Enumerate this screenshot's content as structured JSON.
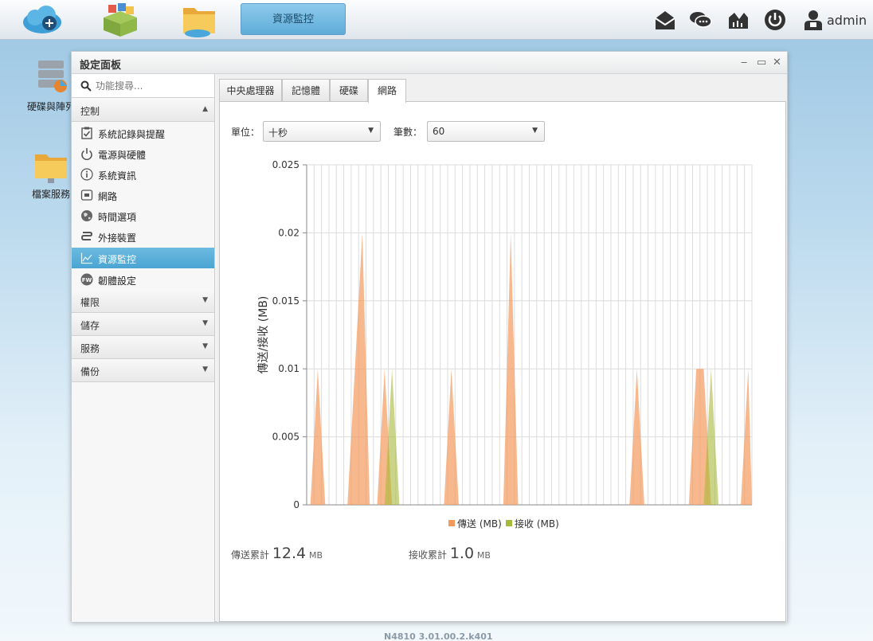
{
  "taskbar": {
    "active_app": "資源監控",
    "user": "admin",
    "right_icons": [
      "mail-icon",
      "chat-icon",
      "network-monitor-icon",
      "power-icon",
      "user-icon"
    ]
  },
  "desktop": {
    "items": [
      {
        "label": "硬碟與陣列",
        "icon": "disk-raid-icon"
      },
      {
        "label": "檔案服務",
        "icon": "file-service-icon"
      }
    ]
  },
  "window": {
    "title": "設定面板",
    "controls": {
      "minimize": "‒",
      "maximize": "▭",
      "close": "✕"
    }
  },
  "sidebar": {
    "search_placeholder": "功能搜尋...",
    "sections": [
      {
        "label": "控制",
        "expanded": true,
        "items": [
          {
            "label": "系統記錄與提醒",
            "icon": "clipboard-check-icon"
          },
          {
            "label": "電源與硬體",
            "icon": "power-icon"
          },
          {
            "label": "系統資訊",
            "icon": "info-icon"
          },
          {
            "label": "網路",
            "icon": "network-port-icon"
          },
          {
            "label": "時間選項",
            "icon": "globe-clock-icon"
          },
          {
            "label": "外接裝置",
            "icon": "usb-icon"
          },
          {
            "label": "資源監控",
            "icon": "chart-line-icon",
            "active": true
          },
          {
            "label": "韌體設定",
            "icon": "firmware-icon"
          }
        ]
      },
      {
        "label": "權限",
        "expanded": false
      },
      {
        "label": "儲存",
        "expanded": false
      },
      {
        "label": "服務",
        "expanded": false
      },
      {
        "label": "備份",
        "expanded": false
      }
    ]
  },
  "tabs": [
    {
      "label": "中央處理器"
    },
    {
      "label": "記憶體"
    },
    {
      "label": "硬碟"
    },
    {
      "label": "網路",
      "active": true
    }
  ],
  "controls": {
    "unit_label": "單位：",
    "unit_value": "十秒",
    "count_label": "筆數：",
    "count_value": "60"
  },
  "chart_data": {
    "type": "area",
    "ylabel": "傳送/接收 (MB)",
    "ylim": [
      0,
      0.025
    ],
    "yticks": [
      "0",
      "0.005",
      "0.01",
      "0.015",
      "0.02",
      "0.025"
    ],
    "ytick_values": [
      0,
      0.005,
      0.01,
      0.015,
      0.02,
      0.025
    ],
    "grid": true,
    "point_count": 60,
    "series": [
      {
        "name": "傳送 (MB)",
        "color": "#f59a5c",
        "values": [
          0,
          0.01,
          0,
          0,
          0,
          0,
          0.01,
          0.02,
          0,
          0,
          0.01,
          0,
          0,
          0,
          0,
          0,
          0,
          0,
          0,
          0.01,
          0,
          0,
          0,
          0,
          0,
          0,
          0,
          0.02,
          0,
          0,
          0,
          0,
          0,
          0,
          0,
          0,
          0,
          0,
          0,
          0,
          0,
          0,
          0,
          0,
          0.01,
          0,
          0,
          0,
          0,
          0,
          0,
          0,
          0.01,
          0.01,
          0,
          0,
          0,
          0,
          0,
          0.01
        ]
      },
      {
        "name": "接收 (MB)",
        "color": "#a8b93a",
        "values": [
          0,
          0,
          0,
          0,
          0,
          0,
          0,
          0,
          0,
          0,
          0,
          0.01,
          0,
          0,
          0,
          0,
          0,
          0,
          0,
          0,
          0,
          0,
          0,
          0,
          0,
          0,
          0,
          0,
          0,
          0,
          0,
          0,
          0,
          0,
          0,
          0,
          0,
          0,
          0,
          0,
          0,
          0,
          0,
          0,
          0,
          0,
          0,
          0,
          0,
          0,
          0,
          0,
          0,
          0,
          0.01,
          0,
          0,
          0,
          0,
          0
        ]
      }
    ],
    "legend_position": "bottom"
  },
  "totals": {
    "sent_label": "傳送累計",
    "sent_value": "12.4",
    "sent_unit": "MB",
    "recv_label": "接收累計",
    "recv_value": "1.0",
    "recv_unit": "MB"
  },
  "footer": "N4810   3.01.00.2.k401"
}
